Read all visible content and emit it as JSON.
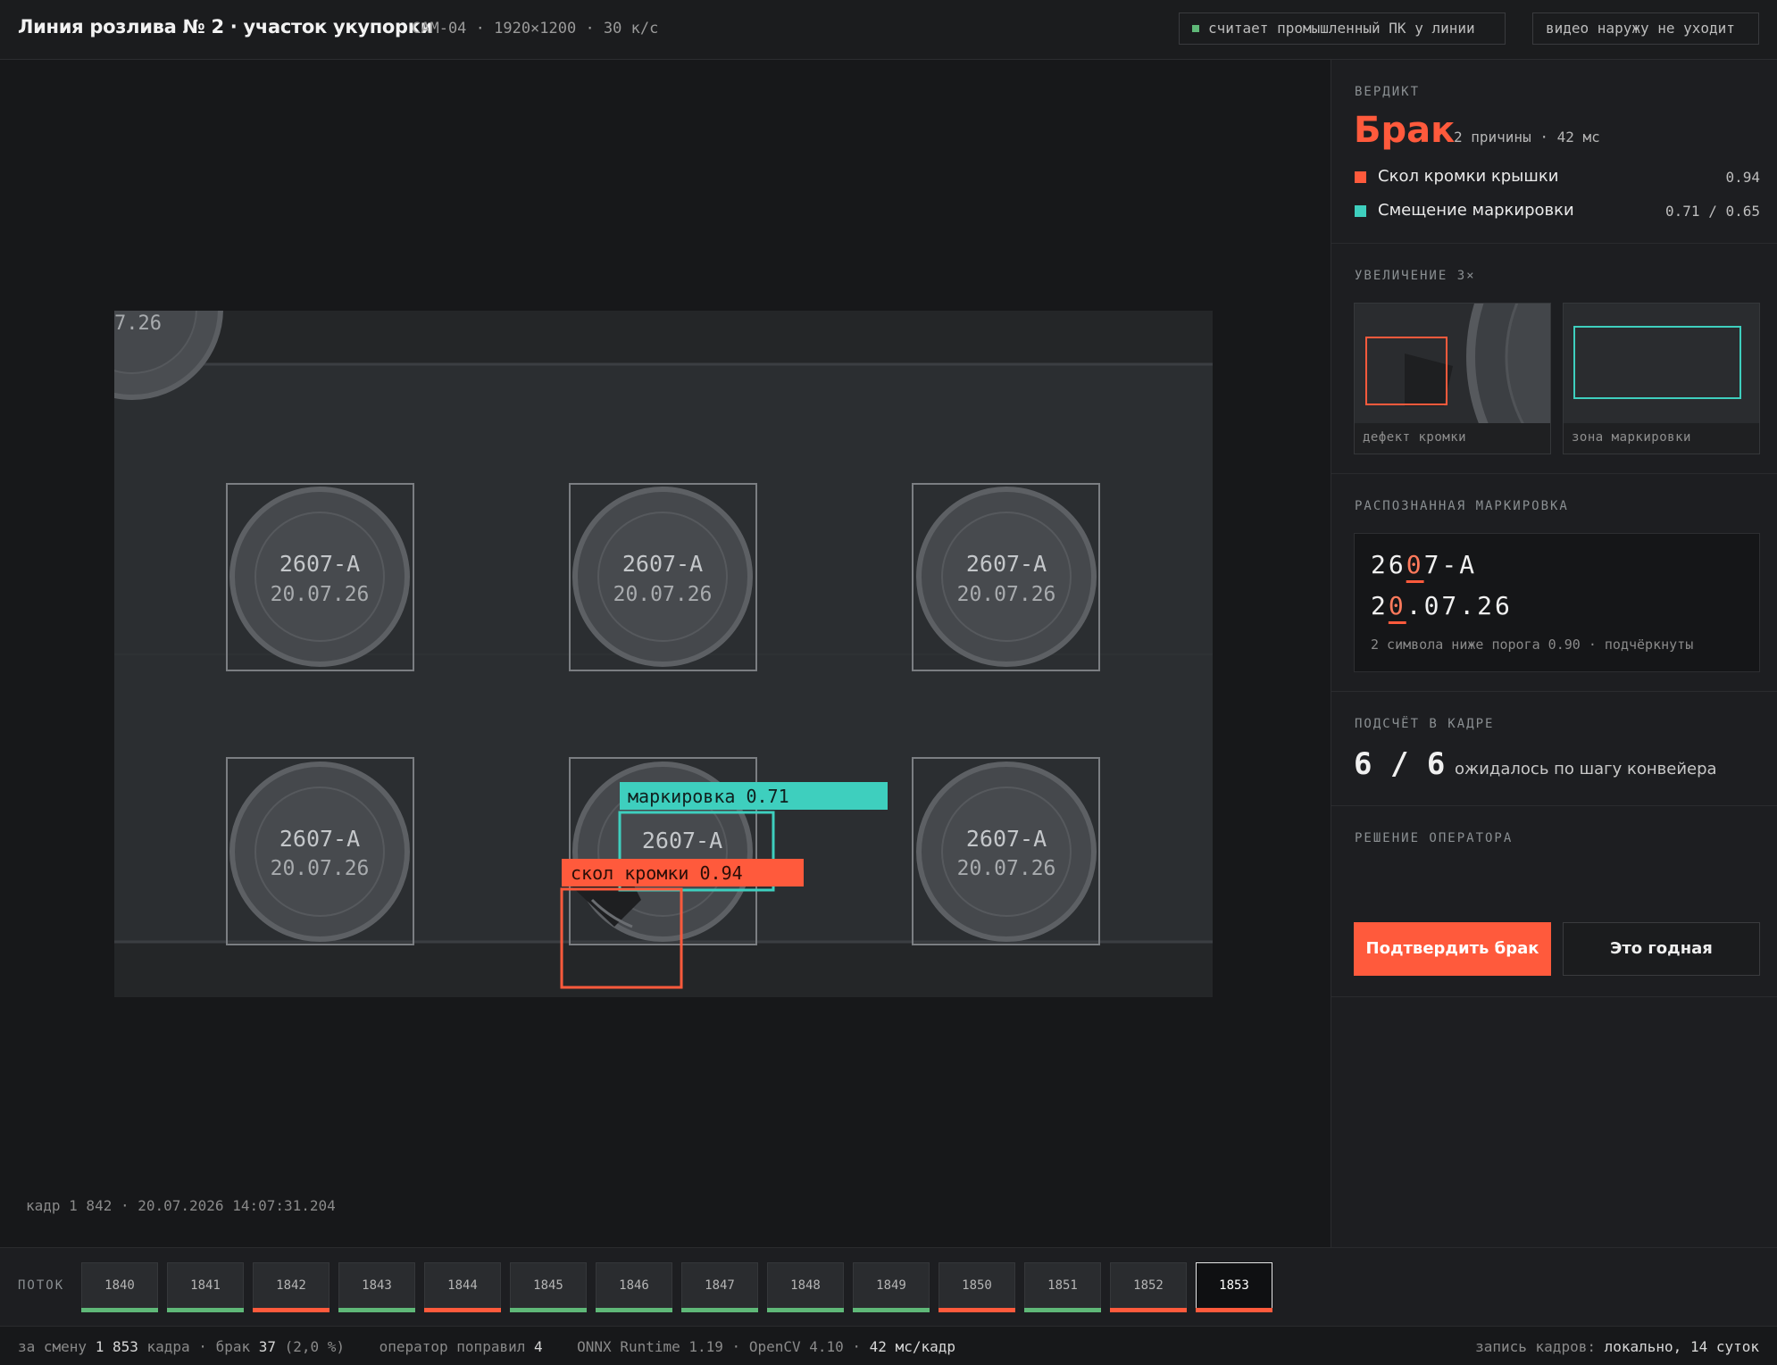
{
  "header": {
    "title": "Линия розлива № 2 · участок укупорки",
    "camera": "CAM-04 · 1920×1200 · 30 к/с",
    "pill_compute": "считает промышленный ПК у линии",
    "pill_video": "видео наружу не уходит"
  },
  "frame": {
    "caps": [
      {
        "code": "2607-A",
        "date": "20.07.26"
      },
      {
        "code": "2607-A",
        "date": "20.07.26"
      },
      {
        "code": "2607-A",
        "date": "20.07.26"
      },
      {
        "code": "2607-A",
        "date": "20.07.26"
      },
      {
        "code": "2607-A",
        "date": "20.07.26"
      },
      {
        "code": "2607-A",
        "date": "20.07.26"
      }
    ],
    "partial_cap_text": "7.26",
    "det_marking": "маркировка 0.71",
    "det_chip": "скол кромки 0.94",
    "meta": "кадр 1 842 · 20.07.2026 14:07:31.204"
  },
  "verdict": {
    "label": "ВЕРДИКТ",
    "word": "Брак",
    "sub": "2 причины · 42 мс",
    "reasons": [
      {
        "text": "Скол кромки крышки",
        "score": "0.94",
        "color": "#ff5a3c"
      },
      {
        "text": "Смещение маркировки",
        "score": "0.71 / 0.65",
        "color": "#3ecfbe"
      }
    ]
  },
  "zoom": {
    "label": "УВЕЛИЧЕНИЕ 3×",
    "defect_caption": "дефект кромки",
    "marking_caption": "зона маркировки"
  },
  "ocr": {
    "label": "РАСПОЗНАННАЯ МАРКИРОВКА",
    "line1_a": "26",
    "line1_low": "0",
    "line1_b": "7-A",
    "line2_a": "2",
    "line2_low": "0",
    "line2_b": ".07.26",
    "note": "2 символа ниже порога 0.90 · подчёркнуты"
  },
  "count": {
    "label": "ПОДСЧЁТ В КАДРЕ",
    "value": "6 / 6",
    "sub": "ожидалось по шагу конвейера"
  },
  "decision": {
    "label": "РЕШЕНИЕ ОПЕРАТОРА",
    "confirm": "Подтвердить брак",
    "good": "Это годная"
  },
  "stream": {
    "label": "ПОТОК",
    "frames": [
      {
        "id": "1840",
        "status": "ok"
      },
      {
        "id": "1841",
        "status": "ok"
      },
      {
        "id": "1842",
        "status": "defect"
      },
      {
        "id": "1843",
        "status": "ok"
      },
      {
        "id": "1844",
        "status": "defect"
      },
      {
        "id": "1845",
        "status": "ok"
      },
      {
        "id": "1846",
        "status": "ok"
      },
      {
        "id": "1847",
        "status": "ok"
      },
      {
        "id": "1848",
        "status": "ok"
      },
      {
        "id": "1849",
        "status": "ok"
      },
      {
        "id": "1850",
        "status": "defect"
      },
      {
        "id": "1851",
        "status": "ok"
      },
      {
        "id": "1852",
        "status": "defect"
      },
      {
        "id": "1853",
        "status": "defect",
        "active": true
      }
    ],
    "colors": {
      "ok": "#5fb878",
      "defect": "#ff5a3c"
    }
  },
  "footer": {
    "shift_label": "за смену ",
    "shift_frames": "1 853",
    "frames_word": " кадра · брак ",
    "defects": "37",
    "defect_pct": " (2,0 %)",
    "operator_label": "оператор поправил ",
    "operator_fixed": "4",
    "runtime": "ONNX Runtime 1.19 · OpenCV 4.10 · ",
    "latency": "42 мс/кадр",
    "storage_label": "запись кадров: ",
    "storage": "локально, 14 суток"
  }
}
